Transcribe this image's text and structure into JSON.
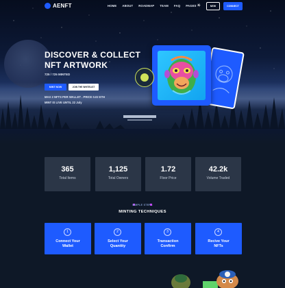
{
  "nav": {
    "logo_text": "AENFT",
    "menu": [
      "HOME",
      "ABOUT",
      "ROADMAP",
      "TEAM",
      "FAQ",
      "PAGES"
    ],
    "theme_icon": "sun-icon",
    "outline_button": "NEW",
    "connect_button": "CONNECT"
  },
  "hero": {
    "title_line1": "DISCOVER & COLLECT",
    "title_line2": "NFT ARTWORK",
    "minted": "725 / 725 MINTED",
    "mint_button": "MINT NOW",
    "whitelist_button": "JOIN THE WHITELIST",
    "info_line1": "MAX 2 NFTS PER WALLET . PRICE 0.02 ETH",
    "info_line2": "MINT IS LIVE UNTIL 22 July"
  },
  "stats": [
    {
      "value": "365",
      "label": "Total Items"
    },
    {
      "value": "1,125",
      "label": "Total Owners"
    },
    {
      "value": "1.72",
      "label": "Floor Price"
    },
    {
      "value": "42.2k",
      "label": "Volume Traded"
    }
  ],
  "section": {
    "small_label": "SIMPLE STEPS",
    "title": "MINTING TECHNIQUES"
  },
  "steps": [
    {
      "number": "1",
      "line1": "Connect Your",
      "line2": "Wallet"
    },
    {
      "number": "2",
      "line1": "Select Your",
      "line2": "Quantity"
    },
    {
      "number": "3",
      "line1": "Transaction",
      "line2": "Confirm"
    },
    {
      "number": "4",
      "line1": "Recive Your",
      "line2": "NFTs"
    }
  ],
  "colors": {
    "background": "#0e1827",
    "accent": "#1e5bff",
    "card": "#2b3647",
    "badge": "#cfe35a"
  }
}
